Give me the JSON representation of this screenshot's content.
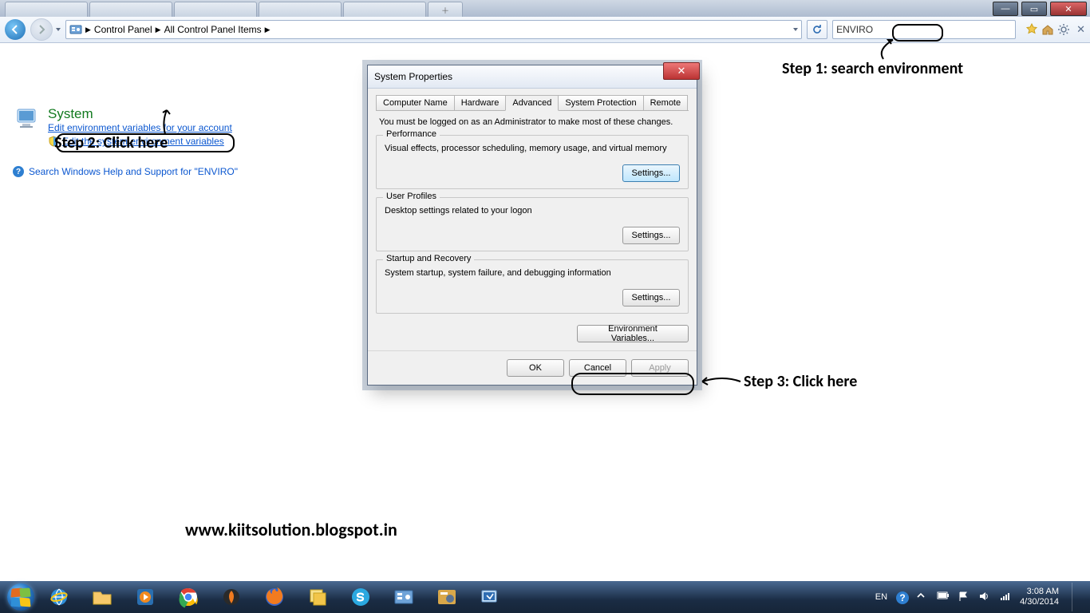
{
  "chrome": {
    "tabNew": "＋"
  },
  "toolbar": {
    "crumb1": "Control Panel",
    "crumb2": "All Control Panel Items",
    "searchValue": "ENVIRO"
  },
  "results": {
    "heading": "System",
    "link1": "Edit environment variables for your account",
    "link2": "Edit the system environment variables",
    "helpLink": "Search Windows Help and Support for \"ENVIRO\""
  },
  "dialog": {
    "title": "System Properties",
    "tabs": {
      "computerName": "Computer Name",
      "hardware": "Hardware",
      "advanced": "Advanced",
      "systemProtection": "System Protection",
      "remote": "Remote"
    },
    "note": "You must be logged on as an Administrator to make most of these changes.",
    "performance": {
      "title": "Performance",
      "desc": "Visual effects, processor scheduling, memory usage, and virtual memory",
      "btn": "Settings..."
    },
    "userProfiles": {
      "title": "User Profiles",
      "desc": "Desktop settings related to your logon",
      "btn": "Settings..."
    },
    "startup": {
      "title": "Startup and Recovery",
      "desc": "System startup, system failure, and debugging information",
      "btn": "Settings..."
    },
    "envBtn": "Environment Variables...",
    "ok": "OK",
    "cancel": "Cancel",
    "apply": "Apply"
  },
  "anno": {
    "step1": "Step 1: search environment",
    "step2": "Step 2: Click here",
    "step3": "Step 3: Click here",
    "url": "www.kiitsolution.blogspot.in"
  },
  "tray": {
    "lang": "EN",
    "time": "3:08 AM",
    "date": "4/30/2014"
  }
}
